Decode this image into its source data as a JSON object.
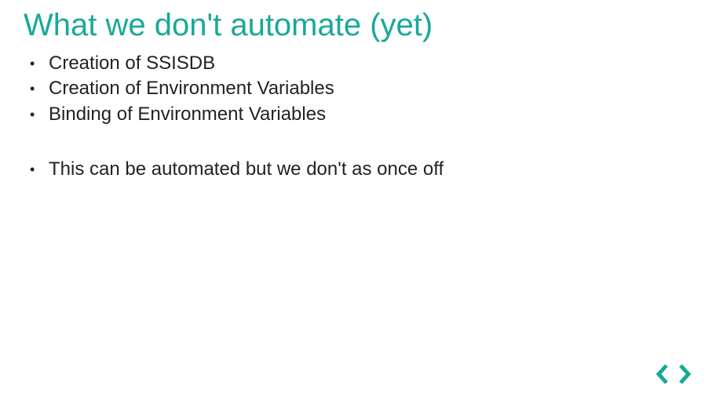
{
  "title": "What we don't automate (yet)",
  "bullets_group1": [
    "Creation of SSISDB",
    "Creation of Environment Variables",
    "Binding of Environment Variables"
  ],
  "bullets_group2": [
    "This can be automated but we don't as once off"
  ],
  "logo_color": "#18a999"
}
